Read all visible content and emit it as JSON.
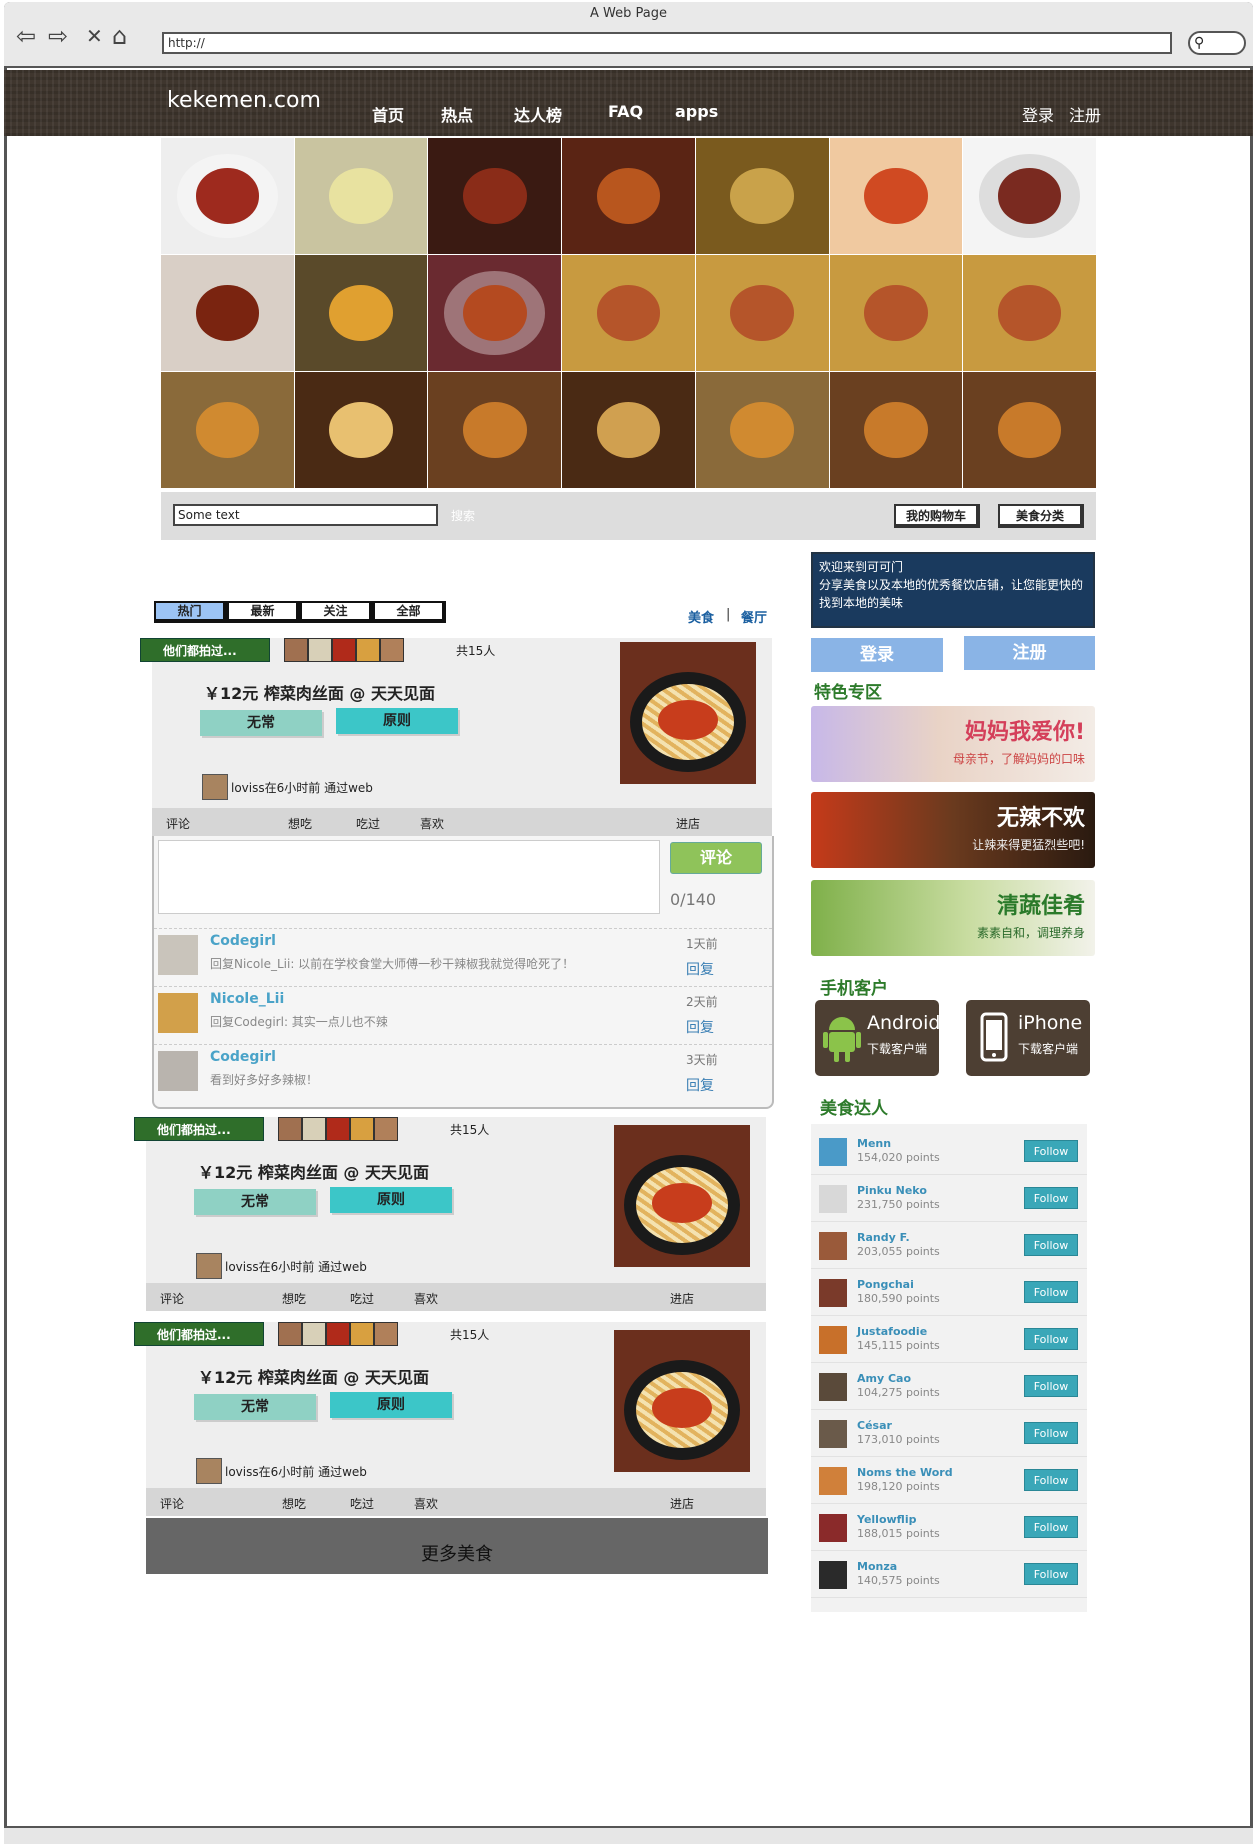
{
  "browser": {
    "window_title": "A Web Page",
    "url": "http://"
  },
  "header": {
    "logo": "kekemen.com",
    "nav": [
      "首页",
      "热点",
      "达人榜",
      "FAQ",
      "apps"
    ],
    "login": "登录",
    "register": "注册"
  },
  "search": {
    "value": "Some text",
    "button": "搜索",
    "cart": "我的购物车",
    "category": "美食分类"
  },
  "tabs": [
    "热门",
    "最新",
    "关注",
    "全部"
  ],
  "filters": {
    "food": "美食",
    "divider": "|",
    "restaurant": "餐厅"
  },
  "post": {
    "ribbon": "他们都拍过...",
    "total": "共15人",
    "title": "￥12元 榨菜肉丝面 @ 天天见面",
    "tag1": "无常",
    "tag2": "原则",
    "meta": "loviss在6小时前 通过web",
    "actions": {
      "comment": "评论",
      "want": "想吃",
      "ate": "吃过",
      "like": "喜欢",
      "shop": "进店"
    }
  },
  "comments": {
    "button": "评论",
    "counter": "0/140",
    "items": [
      {
        "name": "Codegirl",
        "text": "回复Nicole_Lii: 以前在学校食堂大师傅一秒干辣椒我就觉得呛死了！",
        "time": "1天前",
        "reply": "回复"
      },
      {
        "name": "Nicole_Lii",
        "text": "回复Codegirl: 其实一点儿也不辣",
        "time": "2天前",
        "reply": "回复"
      },
      {
        "name": "Codegirl",
        "text": "看到好多好多辣椒！",
        "time": "3天前",
        "reply": "回复"
      }
    ]
  },
  "more": "更多美食",
  "sidebar": {
    "welcome_title": "欢迎来到可可门",
    "welcome_text": "分享美食以及本地的优秀餐饮店铺，让您能更快的找到本地的美味",
    "login": "登录",
    "register": "注册",
    "featured_title": "特色专区",
    "banners": [
      {
        "title": "妈妈我爱你!",
        "sub": "母亲节，了解妈妈的口味"
      },
      {
        "title": "无辣不欢",
        "sub": "让辣来得更猛烈些吧!"
      },
      {
        "title": "清蔬佳肴",
        "sub": "素素自和，调理养身"
      }
    ],
    "mobile_title": "手机客户",
    "apps": [
      {
        "name": "Android",
        "desc": "下载客户端"
      },
      {
        "name": "iPhone",
        "desc": "下载客户端"
      }
    ],
    "experts_title": "美食达人",
    "follow": "Follow",
    "experts": [
      {
        "name": "Menn",
        "points": "154,020 points"
      },
      {
        "name": "Pinku Neko",
        "points": "231,750 points"
      },
      {
        "name": "Randy F.",
        "points": "203,055 points"
      },
      {
        "name": "Pongchai",
        "points": "180,590 points"
      },
      {
        "name": "Justafoodie",
        "points": "145,115 points"
      },
      {
        "name": "Amy Cao",
        "points": "104,275 points"
      },
      {
        "name": "César",
        "points": "173,010 points"
      },
      {
        "name": "Noms the Word",
        "points": "198,120 points"
      },
      {
        "name": "Yellowflip",
        "points": "188,015 points"
      },
      {
        "name": "Monza",
        "points": "140,575 points"
      }
    ]
  }
}
